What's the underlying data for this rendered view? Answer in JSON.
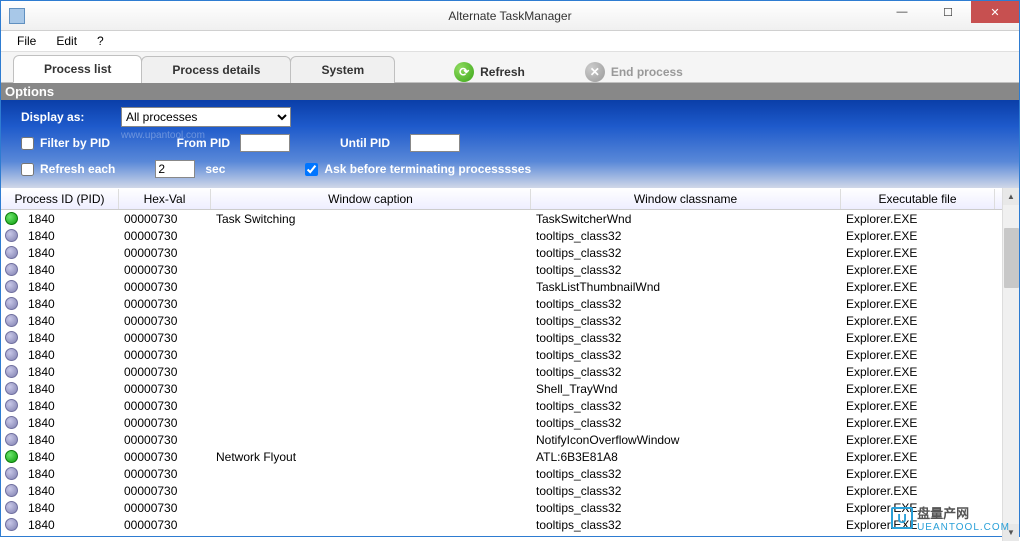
{
  "window": {
    "title": "Alternate TaskManager"
  },
  "menu": {
    "file": "File",
    "edit": "Edit",
    "help": "?"
  },
  "tabs": {
    "process_list": "Process list",
    "process_details": "Process details",
    "system": "System"
  },
  "actions": {
    "refresh": "Refresh",
    "end_process": "End process"
  },
  "options": {
    "header": "Options",
    "display_as_label": "Display as:",
    "display_as_value": "All processes",
    "filter_by_pid": "Filter by PID",
    "from_pid": "From PID",
    "until_pid": "Until PID",
    "refresh_each": "Refresh each",
    "refresh_value": "2",
    "sec": "sec",
    "ask_before": "Ask before terminating processsses",
    "watermark": "www.upantool.com"
  },
  "columns": {
    "pid": "Process ID (PID)",
    "hex": "Hex-Val",
    "caption": "Window caption",
    "classname": "Window classname",
    "exe": "Executable file"
  },
  "rows": [
    {
      "pid": "1840",
      "hex": "00000730",
      "caption": "Task Switching",
      "classname": "TaskSwitcherWnd",
      "exe": "Explorer.EXE",
      "active": true
    },
    {
      "pid": "1840",
      "hex": "00000730",
      "caption": "",
      "classname": "tooltips_class32",
      "exe": "Explorer.EXE",
      "active": false
    },
    {
      "pid": "1840",
      "hex": "00000730",
      "caption": "",
      "classname": "tooltips_class32",
      "exe": "Explorer.EXE",
      "active": false
    },
    {
      "pid": "1840",
      "hex": "00000730",
      "caption": "",
      "classname": "tooltips_class32",
      "exe": "Explorer.EXE",
      "active": false
    },
    {
      "pid": "1840",
      "hex": "00000730",
      "caption": "",
      "classname": "TaskListThumbnailWnd",
      "exe": "Explorer.EXE",
      "active": false
    },
    {
      "pid": "1840",
      "hex": "00000730",
      "caption": "",
      "classname": "tooltips_class32",
      "exe": "Explorer.EXE",
      "active": false
    },
    {
      "pid": "1840",
      "hex": "00000730",
      "caption": "",
      "classname": "tooltips_class32",
      "exe": "Explorer.EXE",
      "active": false
    },
    {
      "pid": "1840",
      "hex": "00000730",
      "caption": "",
      "classname": "tooltips_class32",
      "exe": "Explorer.EXE",
      "active": false
    },
    {
      "pid": "1840",
      "hex": "00000730",
      "caption": "",
      "classname": "tooltips_class32",
      "exe": "Explorer.EXE",
      "active": false
    },
    {
      "pid": "1840",
      "hex": "00000730",
      "caption": "",
      "classname": "tooltips_class32",
      "exe": "Explorer.EXE",
      "active": false
    },
    {
      "pid": "1840",
      "hex": "00000730",
      "caption": "",
      "classname": "Shell_TrayWnd",
      "exe": "Explorer.EXE",
      "active": false
    },
    {
      "pid": "1840",
      "hex": "00000730",
      "caption": "",
      "classname": "tooltips_class32",
      "exe": "Explorer.EXE",
      "active": false
    },
    {
      "pid": "1840",
      "hex": "00000730",
      "caption": "",
      "classname": "tooltips_class32",
      "exe": "Explorer.EXE",
      "active": false
    },
    {
      "pid": "1840",
      "hex": "00000730",
      "caption": "",
      "classname": "NotifyIconOverflowWindow",
      "exe": "Explorer.EXE",
      "active": false
    },
    {
      "pid": "1840",
      "hex": "00000730",
      "caption": "Network Flyout",
      "classname": "ATL:6B3E81A8",
      "exe": "Explorer.EXE",
      "active": true
    },
    {
      "pid": "1840",
      "hex": "00000730",
      "caption": "",
      "classname": "tooltips_class32",
      "exe": "Explorer.EXE",
      "active": false
    },
    {
      "pid": "1840",
      "hex": "00000730",
      "caption": "",
      "classname": "tooltips_class32",
      "exe": "Explorer.EXE",
      "active": false
    },
    {
      "pid": "1840",
      "hex": "00000730",
      "caption": "",
      "classname": "tooltips_class32",
      "exe": "Explorer.EXE",
      "active": false
    },
    {
      "pid": "1840",
      "hex": "00000730",
      "caption": "",
      "classname": "tooltips_class32",
      "exe": "Explorer.EXE",
      "active": false
    }
  ],
  "footer": {
    "brand": "盘量产网",
    "sub": "UEANTOOL.COM",
    "logo": "U"
  }
}
